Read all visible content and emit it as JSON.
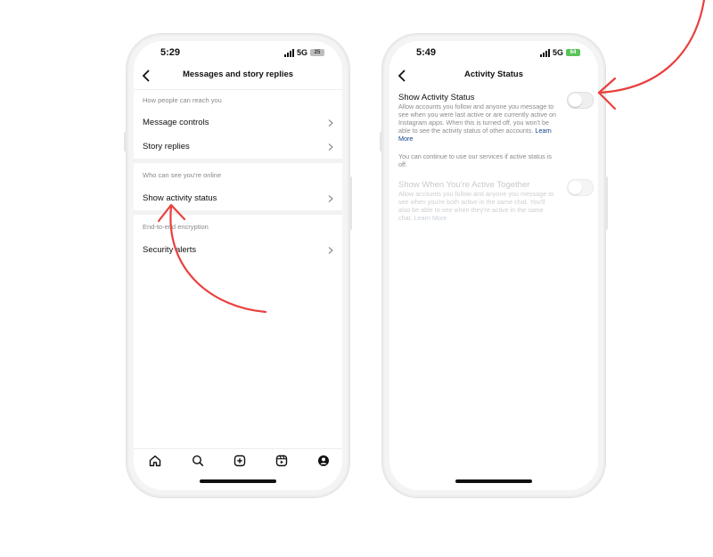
{
  "left_phone": {
    "status": {
      "time": "5:29",
      "network": "5G",
      "battery": "25"
    },
    "header": {
      "title": "Messages and story replies"
    },
    "sections": [
      {
        "heading": "How people can reach you",
        "items": [
          "Message controls",
          "Story replies"
        ]
      },
      {
        "heading": "Who can see you're online",
        "items": [
          "Show activity status"
        ]
      },
      {
        "heading": "End-to-end encryption",
        "items": [
          "Security alerts"
        ]
      }
    ],
    "tabbar": [
      "home-icon",
      "search-icon",
      "create-icon",
      "reels-icon",
      "profile-icon"
    ]
  },
  "right_phone": {
    "status": {
      "time": "5:49",
      "network": "5G",
      "battery": "64"
    },
    "header": {
      "title": "Activity Status"
    },
    "activity_status": {
      "label": "Show Activity Status",
      "description": "Allow accounts you follow and anyone you message to see when you were last active or are currently active on Instagram apps. When this is turned off, you won't be able to see the activity status of other accounts.",
      "learn_more": "Learn More",
      "note": "You can continue to use our services if active status is off.",
      "enabled": false
    },
    "active_together": {
      "label": "Show When You're Active Together",
      "description": "Allow accounts you follow and anyone you message to see when you're both active in the same chat. You'll also be able to see when they're active in the same chat.",
      "learn_more": "Learn More",
      "enabled": false
    }
  },
  "annotation_color": "#e8403e"
}
